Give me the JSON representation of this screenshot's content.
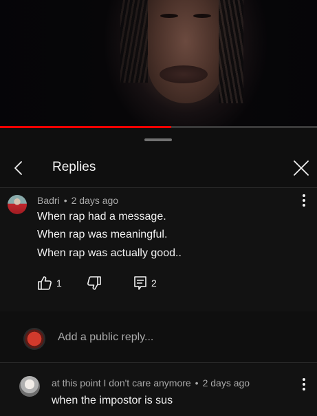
{
  "video": {
    "progress": 0.54
  },
  "header": {
    "title": "Replies",
    "back_icon": "chevron-left-icon",
    "close_icon": "close-icon"
  },
  "comment": {
    "author": "Badri",
    "separator": "•",
    "time": "2 days ago",
    "lines": [
      "When rap had a message.",
      "When rap was meaningful.",
      "When rap was actually good.."
    ],
    "likes": "1",
    "replies": "2"
  },
  "reply_input": {
    "placeholder": "Add a public reply..."
  },
  "replies": [
    {
      "author": "at this point I don't care anymore",
      "separator": "•",
      "time": "2 days ago",
      "text": "when the impostor is sus"
    }
  ],
  "colors": {
    "accent": "#ff0000",
    "background": "#0f0f0f",
    "text": "#f1f1f1",
    "secondary": "#aaaaaa"
  }
}
